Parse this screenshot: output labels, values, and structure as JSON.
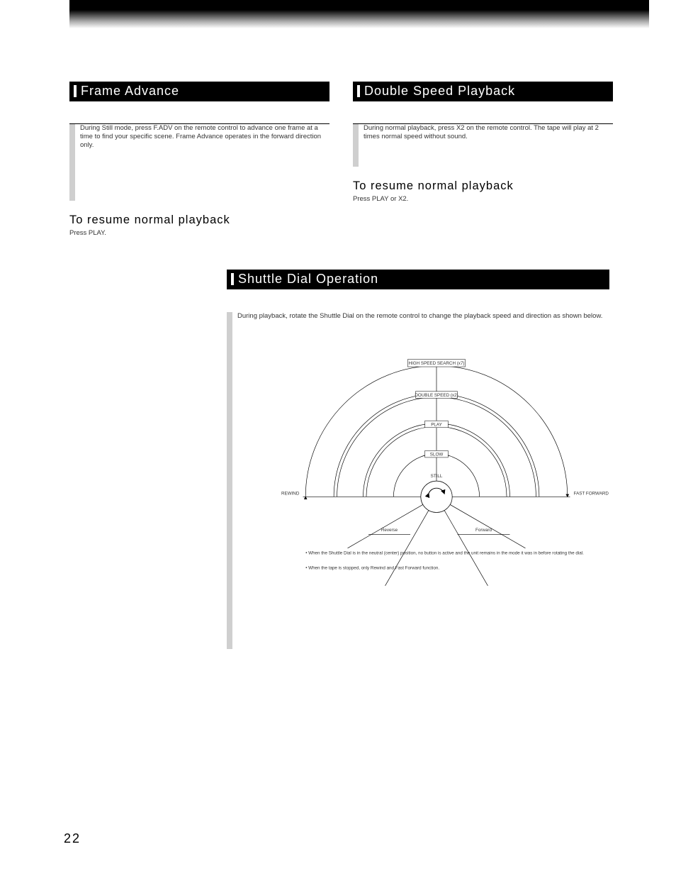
{
  "page_number": "22",
  "left": {
    "heading": "Frame Advance",
    "body": "During Still mode, press F.ADV on the remote control to advance one frame at a time to find your specific scene. Frame Advance operates in the forward direction only.",
    "resume_heading": "To resume normal playback",
    "resume_body": "Press PLAY."
  },
  "right": {
    "heading": "Double Speed Playback",
    "body": "During normal playback, press X2 on the remote control. The tape will play at 2 times normal speed without sound.",
    "resume_heading": "To resume normal playback",
    "resume_body": "Press PLAY or X2."
  },
  "shuttle": {
    "heading": "Shuttle Dial Operation",
    "intro": "During playback, rotate the Shuttle Dial on the remote control to change the playback speed and direction as shown below.",
    "labels": {
      "high": "HIGH SPEED SEARCH (x7)",
      "double": "DOUBLE SPEED (x2)",
      "play": "PLAY",
      "slow": "SLOW",
      "still": "STILL",
      "rewind": "REWIND",
      "fastfwd": "FAST FORWARD"
    },
    "note_rev": "Reverse",
    "note_fwd": "Forward",
    "note_neutral": "• When the Shuttle Dial is in the neutral (center) position, no button is active and the unit remains in the mode it was in before rotating the dial.",
    "note_stop": "• When the tape is stopped, only Rewind and Fast Forward function."
  }
}
